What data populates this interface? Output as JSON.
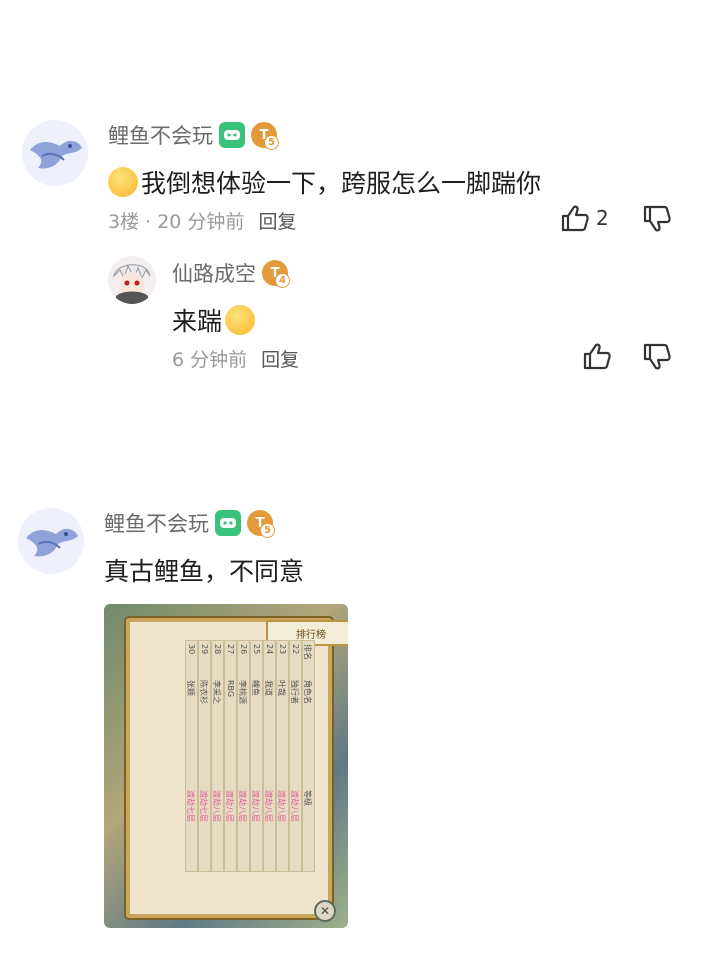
{
  "comments": [
    {
      "user": "鲤鱼不会玩",
      "level": "5",
      "text": "我倒想体验一下，跨服怎么一脚踹你",
      "floor_time": "3楼 · 20 分钟前",
      "reply_label": "回复",
      "like_count": "2",
      "replies": [
        {
          "user": "仙路成空",
          "level": "4",
          "text": "来踹",
          "time": "6 分钟前",
          "reply_label": "回复"
        }
      ]
    },
    {
      "user": "鲤鱼不会玩",
      "level": "5",
      "text": "真古鲤鱼，不同意",
      "image": {
        "title": "排行榜",
        "header": [
          "排名",
          "角色名",
          "等级"
        ],
        "rows": [
          [
            "22",
            "独行者",
            "渡劫八层"
          ],
          [
            "23",
            "叶哉",
            "渡劫八层"
          ],
          [
            "24",
            "我道",
            "渡劫八层"
          ],
          [
            "25",
            "鲤鱼",
            "渡劫八层"
          ],
          [
            "26",
            "李桃源",
            "渡劫八层"
          ],
          [
            "27",
            "RBG",
            "渡劫八层"
          ],
          [
            "28",
            "李采之",
            "渡劫八层"
          ],
          [
            "29",
            "陈衣衫",
            "渡劫七层"
          ],
          [
            "30",
            "张颖",
            "渡劫七层"
          ]
        ]
      }
    }
  ],
  "icons": {
    "game_badge": "gamepad-icon",
    "level_badge": "level-badge-icon",
    "like": "thumbs-up-icon",
    "dislike": "thumbs-down-icon"
  },
  "colors": {
    "username": "#6b6b6b",
    "game_badge": "#39c27a",
    "level_badge": "#e39a3b"
  }
}
